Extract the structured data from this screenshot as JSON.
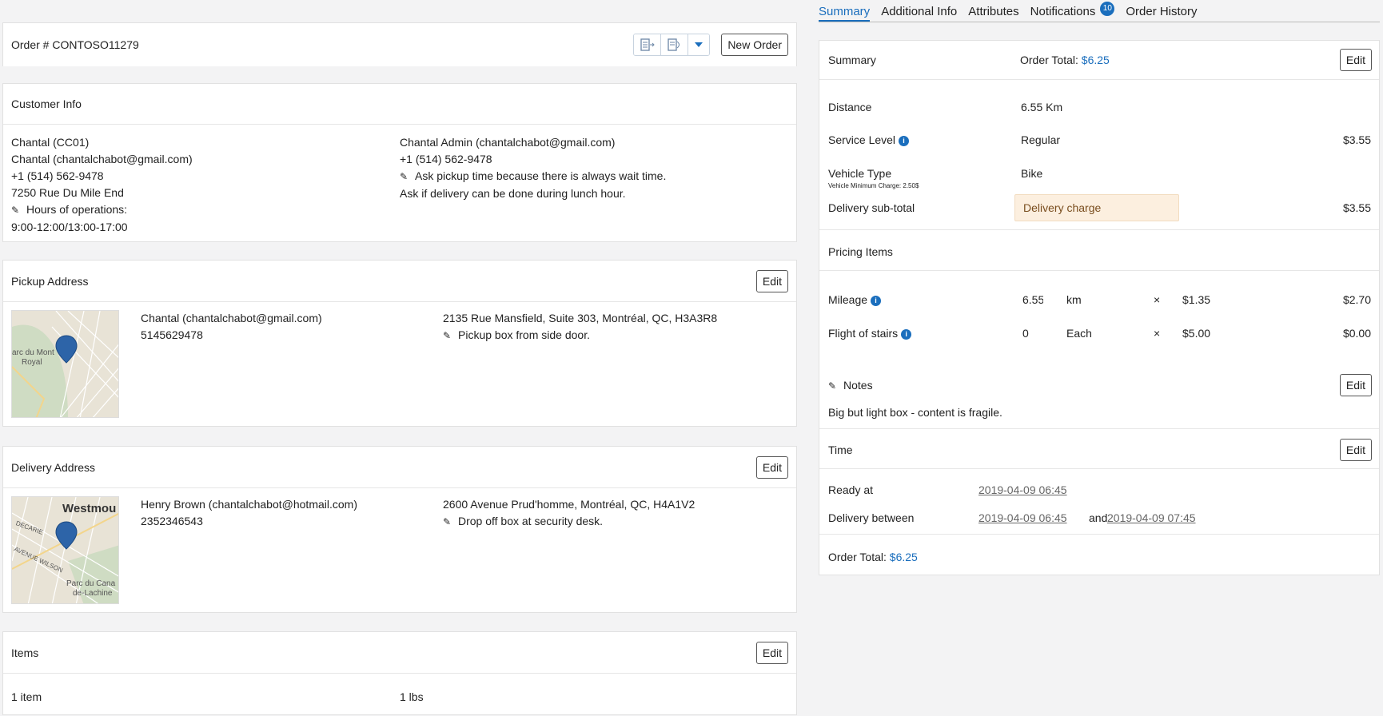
{
  "order": {
    "title": "Order # CONTOSO11279",
    "new_order_label": "New Order"
  },
  "customer": {
    "section_title": "Customer Info",
    "left": [
      "Chantal (CC01)",
      "Chantal (chantalchabot@gmail.com)",
      "+1 (514) 562-9478",
      "7250 Rue Du Mile End"
    ],
    "hours_label": "Hours of operations:",
    "hours_value": "9:00-12:00/13:00-17:00",
    "right": [
      "Chantal Admin (chantalchabot@gmail.com)",
      "+1 (514) 562-9478"
    ],
    "note1": "Ask pickup time because there is always wait time.",
    "note2": "Ask if delivery can be done during lunch hour."
  },
  "pickup": {
    "section_title": "Pickup Address",
    "edit_label": "Edit",
    "contact": "Chantal (chantalchabot@gmail.com)",
    "phone": "5145629478",
    "address": "2135 Rue Mansfield, Suite 303, Montréal, QC, H3A3R8",
    "note": "Pickup box from side door.",
    "map_labels": [
      "arc du Mont",
      "Royal"
    ]
  },
  "delivery": {
    "section_title": "Delivery Address",
    "edit_label": "Edit",
    "contact": "Henry Brown (chantalchabot@hotmail.com)",
    "phone": "2352346543",
    "address": "2600 Avenue Prud'homme, Montréal, QC, H4A1V2",
    "note": "Drop off box at security desk.",
    "map_labels": [
      "Westmou",
      "DECARIE",
      "AVENUE WILSON",
      "Parc du Cana",
      "de-Lachine"
    ]
  },
  "items": {
    "section_title": "Items",
    "edit_label": "Edit",
    "count": "1 item",
    "weight": "1 lbs"
  },
  "tabs": [
    {
      "label": "Summary",
      "active": true
    },
    {
      "label": "Additional Info"
    },
    {
      "label": "Attributes"
    },
    {
      "label": "Notifications",
      "badge": "10"
    },
    {
      "label": "Order History"
    }
  ],
  "summary": {
    "heading": "Summary",
    "order_total_label": "Order Total:",
    "order_total_value": "$6.25",
    "edit_label": "Edit",
    "distance_label": "Distance",
    "distance_value": "6.55 Km",
    "service_level_label": "Service Level",
    "service_level_value": "Regular",
    "service_level_amount": "$3.55",
    "vehicle_type_label": "Vehicle Type",
    "vehicle_min_charge": "Vehicle Minimum Charge: 2.50$",
    "vehicle_type_value": "Bike",
    "subtotal_label": "Delivery sub-total",
    "subtotal_tag": "Delivery charge",
    "subtotal_amount": "$3.55",
    "pricing_items_label": "Pricing Items",
    "pricing": [
      {
        "label": "Mileage",
        "qty": "6.55",
        "unit": "km",
        "times": "×",
        "rate": "$1.35",
        "amount": "$2.70"
      },
      {
        "label": "Flight of stairs",
        "qty": "0",
        "unit": "Each",
        "times": "×",
        "rate": "$5.00",
        "amount": "$0.00"
      }
    ],
    "notes_label": "Notes",
    "notes_edit_label": "Edit",
    "notes_text": "Big but light box - content is fragile.",
    "time_label": "Time",
    "time_edit_label": "Edit",
    "ready_at_label": "Ready at",
    "ready_at_value": "2019-04-09 06:45",
    "delivery_between_label": "Delivery between",
    "delivery_from": "2019-04-09 06:45",
    "and_label": "and",
    "delivery_to": "2019-04-09 07:45",
    "footer_total_label": "Order Total:",
    "footer_total_value": "$6.25"
  },
  "colors": {
    "accent": "#1a6ebd",
    "tag_bg": "#fcefdf"
  }
}
